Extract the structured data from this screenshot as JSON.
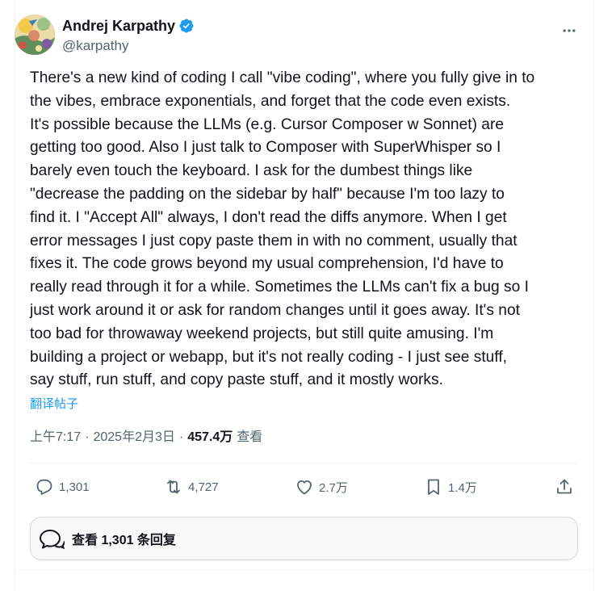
{
  "author": {
    "display_name": "Andrej Karpathy",
    "handle": "@karpathy",
    "verified": true,
    "verified_color": "#1d9bf0"
  },
  "tweet": {
    "text": "There's a new kind of coding I call \"vibe coding\", where you fully give in to\nthe vibes, embrace exponentials, and forget that the code even exists.\nIt's possible because the LLMs (e.g. Cursor Composer w Sonnet) are\ngetting too good. Also I just talk to Composer with SuperWhisper so I\nbarely even touch the keyboard. I ask for the dumbest things like\n\"decrease the padding on the sidebar by half\" because I'm too lazy to\nfind it. I \"Accept All\" always, I don't read the diffs anymore. When I get\nerror messages I just copy paste them in with no comment, usually that\nfixes it. The code grows beyond my usual comprehension, I'd have to\nreally read through it for a while. Sometimes the LLMs can't fix a bug so I\njust work around it or ask for random changes until it goes away. It's not\ntoo bad for throwaway weekend projects, but still quite amusing. I'm\nbuilding a project or webapp, but it's not really coding - I just see stuff,\nsay stuff, run stuff, and copy paste stuff, and it mostly works.",
    "translate_label": "翻译帖子",
    "time": "上午7:17",
    "separator": "·",
    "date": "2025年2月3日",
    "views_count": "457.4万",
    "views_label": "查看"
  },
  "actions": {
    "replies": "1,301",
    "retweets": "4,727",
    "likes": "2.7万",
    "bookmarks": "1.4万"
  },
  "replies_bar": {
    "label": "查看 1,301 条回复"
  },
  "colors": {
    "text": "#0f1419",
    "secondary": "#536471",
    "link": "#1d9bf0",
    "border": "#eff3f4"
  }
}
